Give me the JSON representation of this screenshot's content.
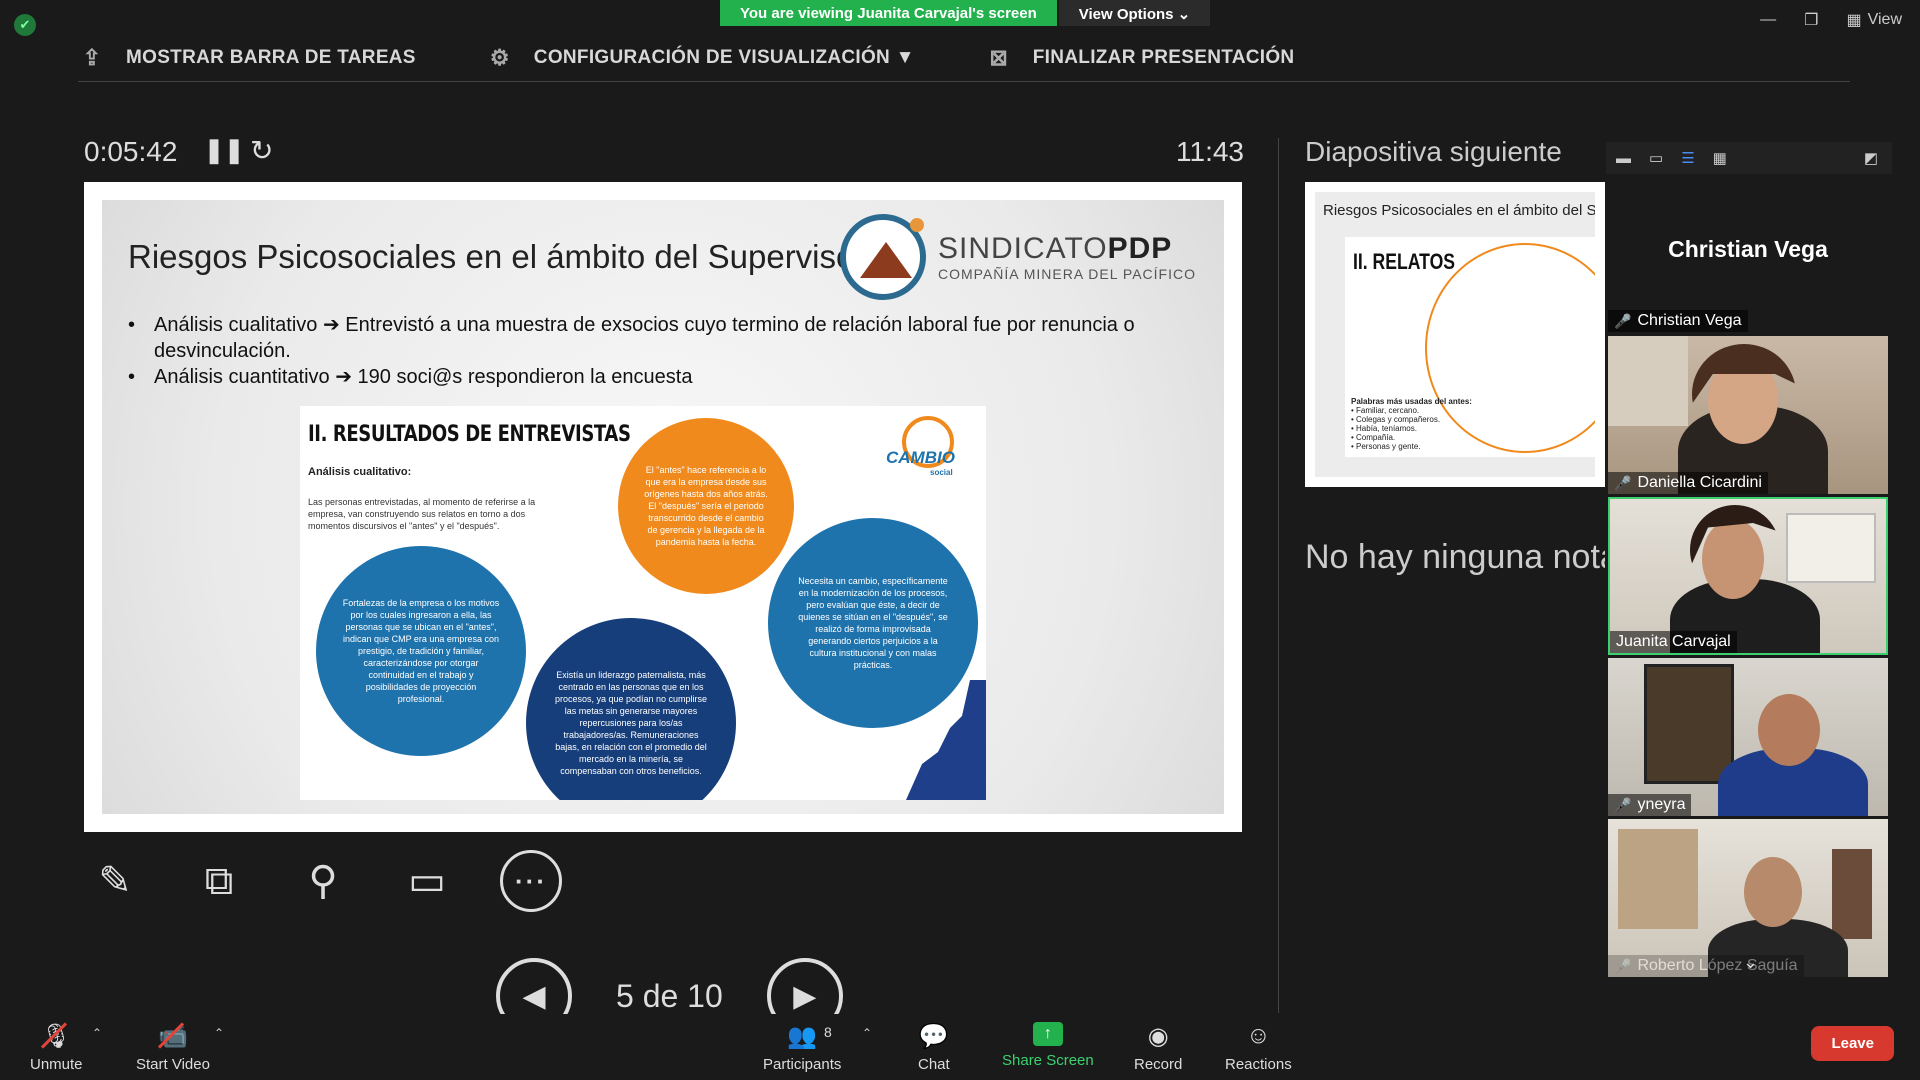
{
  "banner": {
    "viewing": "You are viewing Juanita Carvajal's screen",
    "options": "View Options ⌄"
  },
  "window": {
    "view_label": "View"
  },
  "presenter_toolbar": {
    "show_taskbar": "MOSTRAR BARRA DE TAREAS",
    "display_settings": "CONFIGURACIÓN DE VISUALIZACIÓN ▼",
    "end_presentation": "FINALIZAR PRESENTACIÓN"
  },
  "timer": {
    "elapsed": "0:05:42",
    "clock": "11:43"
  },
  "slide": {
    "title": "Riesgos Psicosociales en el ámbito del Supervisor(a)",
    "brand_main_a": "SINDICATO",
    "brand_main_b": "PDP",
    "brand_sub": "COMPAÑÍA MINERA DEL PACÍFICO",
    "bullets": [
      "Análisis cualitativo ➔ Entrevistó a una muestra de exsocios cuyo termino de relación laboral fue por renuncia o desvinculación.",
      "Análisis cuantitativo ➔ 190 soci@s respondieron la encuesta"
    ],
    "card": {
      "heading": "II. RESULTADOS DE ENTREVISTAS",
      "subheading": "Análisis cualitativo:",
      "paragraph": "Las personas entrevistadas, al momento de referirse a la empresa, van construyendo sus relatos en torno a dos momentos discursivos el \"antes\" y el \"después\".",
      "logo_word": "CAMBIO",
      "logo_sub": "social",
      "circle_orange": "El \"antes\" hace referencia a lo que era la empresa desde sus orígenes hasta dos años atrás. El \"después\" sería el periodo transcurrido desde el cambio de gerencia y la llegada de la pandemia hasta la fecha.",
      "circle_blue1": "Fortalezas de la empresa o los motivos por los cuales ingresaron a ella, las personas que se ubican en el \"antes\", indican que CMP era una empresa con prestigio, de tradición y familiar, caracterizándose por otorgar continuidad en el trabajo y posibilidades de proyección profesional.",
      "circle_navy": "Existía un liderazgo paternalista, más centrado en las personas que en los procesos, ya que podían no cumplirse las metas sin generarse mayores repercusiones para los/as trabajadores/as. Remuneraciones bajas, en relación con el promedio del mercado en la minería, se compensaban con otros beneficios.",
      "circle_blue2": "Necesita un cambio, específicamente en la modernización de los procesos, pero evalúan que éste, a decir de quienes se sitúan en el \"después\", se realizó de forma improvisada generando ciertos perjuicios a la cultura institucional y con malas prácticas."
    }
  },
  "navigation": {
    "page": "5 de 10"
  },
  "next_slide": {
    "label": "Diapositiva siguiente",
    "title": "Riesgos Psicosociales en el ámbito del Su",
    "heading": "II. RELATOS",
    "words_title": "Palabras más usadas del antes:",
    "words": "• Familiar, cercano.\n• Colegas y compañeros.\n• Había, teníamos.\n• Compañía.\n• Personas y gente."
  },
  "notes": {
    "text": "No hay ninguna nota"
  },
  "participants": [
    {
      "name": "Christian Vega",
      "muted": true,
      "video": false
    },
    {
      "name": "Daniella Cicardini",
      "muted": true,
      "video": true
    },
    {
      "name": "Juanita Carvajal",
      "muted": false,
      "video": true,
      "active": true
    },
    {
      "name": "yneyra",
      "muted": true,
      "video": true
    },
    {
      "name": "Roberto López Saguía",
      "muted": true,
      "video": true
    }
  ],
  "bottom_bar": {
    "unmute": "Unmute",
    "start_video": "Start Video",
    "participants": "Participants",
    "participants_count": "8",
    "chat": "Chat",
    "share_screen": "Share Screen",
    "record": "Record",
    "reactions": "Reactions",
    "leave": "Leave"
  },
  "colors": {
    "accent_green": "#23b14d",
    "leave_red": "#d8392e",
    "active_tile": "#3bd16f",
    "slide_orange": "#f08a1c",
    "slide_blue": "#1f73ad",
    "slide_navy": "#163e7b"
  }
}
